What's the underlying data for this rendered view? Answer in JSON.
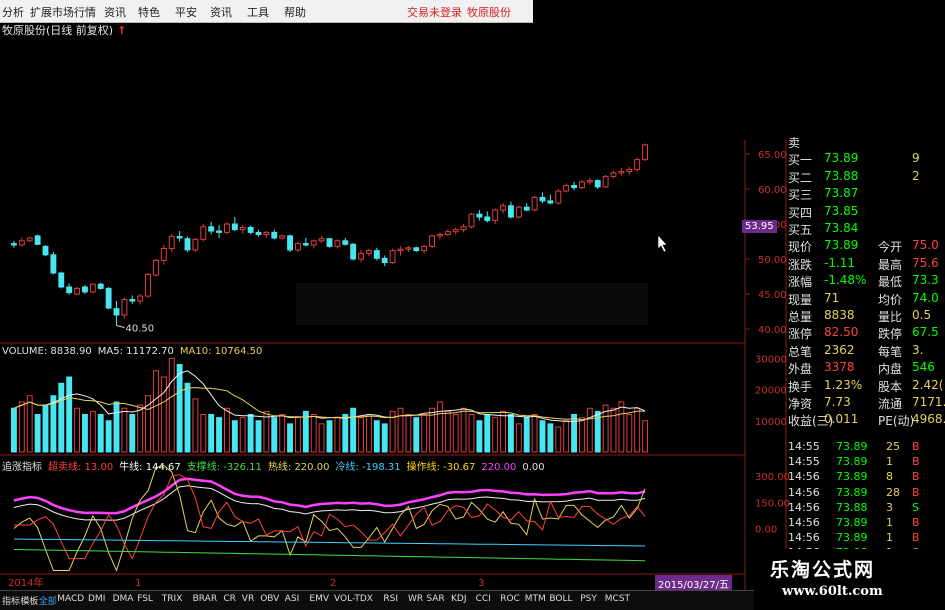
{
  "menu": [
    "分析",
    "扩展市场行情",
    "资讯",
    "特色",
    "平安",
    "资讯",
    "工具",
    "帮助"
  ],
  "menu_alerts": [
    "交易未登录",
    "牧原股份"
  ],
  "chart_title": "牧原股份(日线 前复权)",
  "price_badge": "53.95",
  "price_axis": [
    "65.00",
    "60.00",
    "55.00",
    "50.00",
    "45.00",
    "40.00"
  ],
  "low_label": "40.50",
  "volume": {
    "head": [
      {
        "text": "VOLUME: 8838.90",
        "color": "#e0e0e0"
      },
      {
        "text": "MA5: 11172.70",
        "color": "#e8e8e8"
      },
      {
        "text": "MA10: 10764.50",
        "color": "#e6d25a"
      }
    ],
    "axis": [
      "30000",
      "20000",
      "10000"
    ]
  },
  "indicator": {
    "head": [
      {
        "text": "追涨指标",
        "color": "#e0e0e0"
      },
      {
        "text": "超卖线: 13.00",
        "color": "#ff4040"
      },
      {
        "text": "牛线: 144.67",
        "color": "#ffffff"
      },
      {
        "text": "支撑线: -326.11",
        "color": "#40e040"
      },
      {
        "text": "热线: 220.00",
        "color": "#e6d25a"
      },
      {
        "text": "冷线: -198.31",
        "color": "#40d0ff"
      },
      {
        "text": "操作线: -30.67",
        "color": "#ffd700"
      },
      {
        "text": "220.00",
        "color": "#ff40ff"
      },
      {
        "text": "0.00",
        "color": "#e0e0e0"
      }
    ],
    "axis": [
      "300.00",
      "150.00",
      "0.00",
      "-150.00"
    ]
  },
  "xaxis": [
    "2014年",
    "1",
    "2",
    "3"
  ],
  "date_box": "2015/03/27/五",
  "quote": [
    {
      "l": "卖",
      "v": "",
      "c": "#00ff00",
      "l2": "",
      "v2": "",
      "c2": "#e0e0e0"
    },
    {
      "l": "买一",
      "v": "73.89",
      "c": "#00ff00",
      "l2": "",
      "v2": "9",
      "c2": "#e6d25a"
    },
    {
      "l": "买二",
      "v": "73.88",
      "c": "#00ff00",
      "l2": "",
      "v2": "2",
      "c2": "#e6d25a"
    },
    {
      "l": "买三",
      "v": "73.87",
      "c": "#00ff00",
      "l2": "",
      "v2": "",
      "c2": "#e6d25a"
    },
    {
      "l": "买四",
      "v": "73.85",
      "c": "#00ff00",
      "l2": "",
      "v2": "",
      "c2": "#e6d25a"
    },
    {
      "l": "买五",
      "v": "73.84",
      "c": "#00ff00",
      "l2": "",
      "v2": "",
      "c2": "#e6d25a"
    },
    {
      "l": "现价",
      "v": "73.89",
      "c": "#00ff00",
      "l2": "今开",
      "v2": "75.0",
      "c2": "#ff4040"
    },
    {
      "l": "涨跌",
      "v": "-1.11",
      "c": "#00ff00",
      "l2": "最高",
      "v2": "75.6",
      "c2": "#ff4040"
    },
    {
      "l": "涨幅",
      "v": "-1.48%",
      "c": "#00ff00",
      "l2": "最低",
      "v2": "73.3",
      "c2": "#00ff00"
    },
    {
      "l": "现量",
      "v": "71",
      "c": "#e6d25a",
      "l2": "均价",
      "v2": "74.0",
      "c2": "#00ff00"
    },
    {
      "l": "总量",
      "v": "8838",
      "c": "#e6d25a",
      "l2": "量比",
      "v2": "0.5",
      "c2": "#e6d25a"
    },
    {
      "l": "涨停",
      "v": "82.50",
      "c": "#ff4040",
      "l2": "跌停",
      "v2": "67.5",
      "c2": "#00ff00"
    },
    {
      "l": "总笔",
      "v": "2362",
      "c": "#e6d25a",
      "l2": "每笔",
      "v2": "3.",
      "c2": "#e6d25a"
    },
    {
      "l": "外盘",
      "v": "3378",
      "c": "#ff4040",
      "l2": "内盘",
      "v2": "546",
      "c2": "#00ff00"
    },
    {
      "l": "换手",
      "v": "1.23%",
      "c": "#e6d25a",
      "l2": "股本",
      "v2": "2.42(",
      "c2": "#e6d25a"
    },
    {
      "l": "净资",
      "v": "7.73",
      "c": "#e6d25a",
      "l2": "流通",
      "v2": "7171.",
      "c2": "#e6d25a"
    },
    {
      "l": "收益(三)",
      "v": "0.011",
      "c": "#e6d25a",
      "l2": "PE(动)",
      "v2": "4968.",
      "c2": "#e6d25a"
    }
  ],
  "ticks": [
    {
      "t": "14:55",
      "p": "73.89",
      "n": "25",
      "s": "B"
    },
    {
      "t": "14:55",
      "p": "73.89",
      "n": "1",
      "s": "B"
    },
    {
      "t": "14:56",
      "p": "73.89",
      "n": "8",
      "s": "B"
    },
    {
      "t": "14:56",
      "p": "73.89",
      "n": "28",
      "s": "B"
    },
    {
      "t": "14:56",
      "p": "73.88",
      "n": "3",
      "s": "S"
    },
    {
      "t": "14:56",
      "p": "73.89",
      "n": "1",
      "s": "B"
    },
    {
      "t": "14:56",
      "p": "73.89",
      "n": "1",
      "s": "B"
    },
    {
      "t": "14:56",
      "p": "73.88",
      "n": "1",
      "s": "S"
    }
  ],
  "tabs": [
    "指标",
    "模板",
    "全部",
    "MACD",
    "DMI",
    "DMA",
    "FSL",
    "TRIX",
    "BRAR",
    "CR",
    "VR",
    "OBV",
    "ASI",
    "EMV",
    "VOL-TDX",
    "RSI",
    "WR",
    "SAR",
    "KDJ",
    "CCI",
    "ROC",
    "MTM",
    "BOLL",
    "PSY",
    "MCST"
  ],
  "watermark_1": "乐淘公式网",
  "watermark_2": "www.60lt.com",
  "candles": [
    [
      52.2,
      52.6,
      51.6,
      52.0
    ],
    [
      52.0,
      53.1,
      51.8,
      52.6
    ],
    [
      52.6,
      53.2,
      52.4,
      53.0
    ],
    [
      53.3,
      53.5,
      52.0,
      52.1
    ],
    [
      51.8,
      52.0,
      50.4,
      50.6
    ],
    [
      50.6,
      51.0,
      47.8,
      48.0
    ],
    [
      48.0,
      48.2,
      45.8,
      46.0
    ],
    [
      46.0,
      46.5,
      44.9,
      45.2
    ],
    [
      45.0,
      46.0,
      44.8,
      45.8
    ],
    [
      46.0,
      46.3,
      45.0,
      45.3
    ],
    [
      45.3,
      46.5,
      45.1,
      46.4
    ],
    [
      46.4,
      46.6,
      45.6,
      45.8
    ],
    [
      45.8,
      46.0,
      42.8,
      43.0
    ],
    [
      42.9,
      44.0,
      40.5,
      42.0
    ],
    [
      42.0,
      44.5,
      41.5,
      44.2
    ],
    [
      44.2,
      44.8,
      43.6,
      44.0
    ],
    [
      44.0,
      45.0,
      43.5,
      44.7
    ],
    [
      44.7,
      48.0,
      44.5,
      47.8
    ],
    [
      47.7,
      50.0,
      47.5,
      49.8
    ],
    [
      49.8,
      52.0,
      49.2,
      51.5
    ],
    [
      51.5,
      53.6,
      51.0,
      53.2
    ],
    [
      53.2,
      54.0,
      52.5,
      53.0
    ],
    [
      52.9,
      53.2,
      51.0,
      51.3
    ],
    [
      51.3,
      53.0,
      51.0,
      52.8
    ],
    [
      52.8,
      55.0,
      52.5,
      54.6
    ],
    [
      54.6,
      55.3,
      53.5,
      54.0
    ],
    [
      54.0,
      54.8,
      53.0,
      53.8
    ],
    [
      53.8,
      55.2,
      53.5,
      55.0
    ],
    [
      55.0,
      56.0,
      54.0,
      54.2
    ],
    [
      54.2,
      54.8,
      53.6,
      54.5
    ],
    [
      54.5,
      54.8,
      53.5,
      53.8
    ],
    [
      53.8,
      54.2,
      53.2,
      53.5
    ],
    [
      53.5,
      54.0,
      53.0,
      53.8
    ],
    [
      53.8,
      54.2,
      52.8,
      53.0
    ],
    [
      53.0,
      53.5,
      52.8,
      53.3
    ],
    [
      53.3,
      53.5,
      51.0,
      51.3
    ],
    [
      51.3,
      52.5,
      51.0,
      52.2
    ],
    [
      52.2,
      53.0,
      51.8,
      52.0
    ],
    [
      52.0,
      52.8,
      51.5,
      52.6
    ],
    [
      52.6,
      53.3,
      52.3,
      52.9
    ],
    [
      52.9,
      53.0,
      51.6,
      51.8
    ],
    [
      51.8,
      52.8,
      51.5,
      52.6
    ],
    [
      52.6,
      53.0,
      51.9,
      52.1
    ],
    [
      52.1,
      52.3,
      49.8,
      50.0
    ],
    [
      50.0,
      51.2,
      49.6,
      50.8
    ],
    [
      50.8,
      51.5,
      50.4,
      51.2
    ],
    [
      51.2,
      51.6,
      49.8,
      50.1
    ],
    [
      50.1,
      50.5,
      49.0,
      49.5
    ],
    [
      49.5,
      51.5,
      49.3,
      51.2
    ],
    [
      51.2,
      51.8,
      50.5,
      51.4
    ],
    [
      51.4,
      51.9,
      51.0,
      51.6
    ],
    [
      51.6,
      51.8,
      51.0,
      51.2
    ],
    [
      51.2,
      52.0,
      50.8,
      51.8
    ],
    [
      51.8,
      53.5,
      51.6,
      53.3
    ],
    [
      53.3,
      53.8,
      52.8,
      53.5
    ],
    [
      53.5,
      54.2,
      53.3,
      53.9
    ],
    [
      53.9,
      54.5,
      53.5,
      54.2
    ],
    [
      54.2,
      55.0,
      53.8,
      54.6
    ],
    [
      54.6,
      56.6,
      54.4,
      56.4
    ],
    [
      56.4,
      57.0,
      55.5,
      56.0
    ],
    [
      56.0,
      56.8,
      55.2,
      55.5
    ],
    [
      55.5,
      57.2,
      55.0,
      57.0
    ],
    [
      57.0,
      58.0,
      56.5,
      57.6
    ],
    [
      57.6,
      58.2,
      55.8,
      56.0
    ],
    [
      56.0,
      57.6,
      55.8,
      57.4
    ],
    [
      57.4,
      58.0,
      56.8,
      57.0
    ],
    [
      57.0,
      59.0,
      56.8,
      58.8
    ],
    [
      58.8,
      59.5,
      58.0,
      58.3
    ],
    [
      58.3,
      59.2,
      57.8,
      58.0
    ],
    [
      58.0,
      60.0,
      57.8,
      59.7
    ],
    [
      59.7,
      60.8,
      59.5,
      60.5
    ],
    [
      60.5,
      61.0,
      59.8,
      60.2
    ],
    [
      60.2,
      61.3,
      60.0,
      61.0
    ],
    [
      61.0,
      61.6,
      60.6,
      61.2
    ],
    [
      61.2,
      61.4,
      60.0,
      60.3
    ],
    [
      60.3,
      62.0,
      60.2,
      61.8
    ],
    [
      61.8,
      62.6,
      61.5,
      62.3
    ],
    [
      62.3,
      63.0,
      61.9,
      62.5
    ],
    [
      62.5,
      63.2,
      62.0,
      62.8
    ],
    [
      62.8,
      64.5,
      62.5,
      64.2
    ],
    [
      64.2,
      66.5,
      64.0,
      66.3
    ]
  ],
  "volumes": [
    14,
    16,
    18,
    12,
    15,
    18,
    22,
    24,
    14,
    12,
    13,
    12,
    10,
    16,
    14,
    12,
    15,
    18,
    26,
    24,
    30,
    28,
    22,
    17,
    12,
    12,
    11,
    14,
    10,
    11,
    12,
    10,
    13,
    11,
    12,
    9,
    11,
    13,
    12,
    9,
    10,
    11,
    12,
    14,
    11,
    12,
    10,
    9,
    13,
    14,
    12,
    11,
    12,
    14,
    16,
    13,
    12,
    14,
    12,
    10,
    12,
    11,
    13,
    12,
    9,
    11,
    12,
    10,
    9,
    8,
    10,
    12,
    11,
    14,
    13,
    15,
    14,
    16,
    12,
    14,
    10
  ]
}
